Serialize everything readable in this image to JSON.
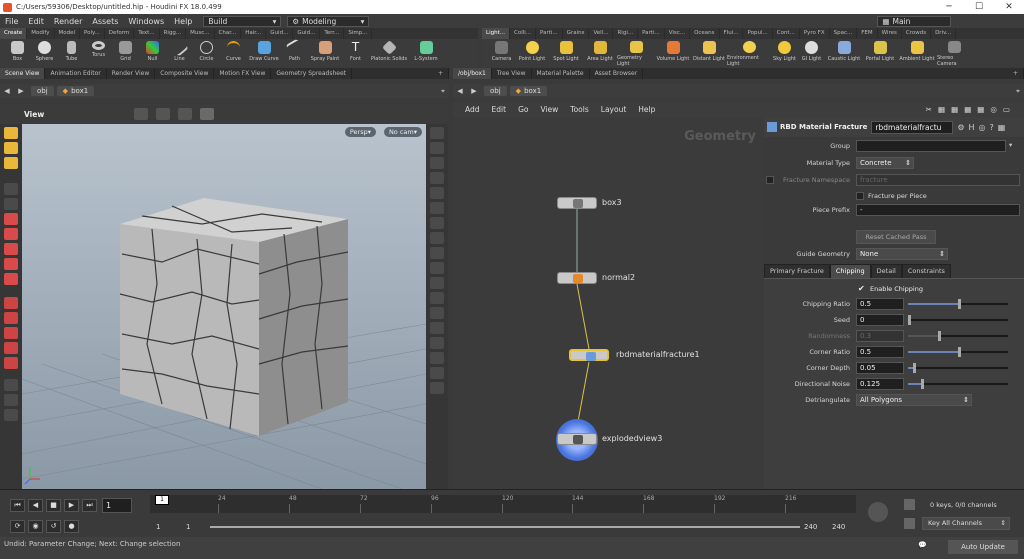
{
  "title": "C:/Users/59306/Desktop/untitled.hip - Houdini FX 18.0.499",
  "menu": [
    "File",
    "Edit",
    "Render",
    "Assets",
    "Windows",
    "Help"
  ],
  "desktop_build": "Build",
  "desktop_modeling": "Modeling",
  "desktop_main": "Main",
  "shelf_tabs_left": [
    "Create",
    "Modify",
    "Model",
    "Poly...",
    "Deform",
    "Text...",
    "Rigg...",
    "Musc...",
    "Char...",
    "Hair...",
    "Guid...",
    "Guid...",
    "Terr...",
    "Simp..."
  ],
  "shelf_tabs_right": [
    "Light...",
    "Colli...",
    "Parti...",
    "Grains",
    "Vell...",
    "Rigi...",
    "Parti...",
    "Visc...",
    "Oceans",
    "Flui...",
    "Popul...",
    "Cont...",
    "Pyro FX",
    "Spac...",
    "FEM",
    "Wires",
    "Crowds",
    "Driv..."
  ],
  "shelf_tools_left": [
    "Box",
    "Sphere",
    "Tube",
    "Torus",
    "Grid",
    "Null",
    "Line",
    "Circle",
    "Curve",
    "Draw Curve",
    "Path",
    "Spray Paint",
    "Font",
    "Platonic Solids",
    "L-System"
  ],
  "shelf_tools_right": [
    "Camera",
    "Point Light",
    "Spot Light",
    "Area Light",
    "Geometry Light",
    "Volume Light",
    "Distant Light",
    "Environment Light",
    "Sky Light",
    "GI Light",
    "Caustic Light",
    "Portal Light",
    "Ambient Light",
    "Stereo Camera"
  ],
  "left_pane_tabs": [
    "Scene View",
    "Animation Editor",
    "Render View",
    "Composite View",
    "Motion FX View",
    "Geometry Spreadsheet"
  ],
  "right_pane_tabs": [
    "/obj/box1",
    "Tree View",
    "Material Palette",
    "Asset Browser"
  ],
  "path_obj": "obj",
  "path_box": "box1",
  "view_label": "View",
  "persp": "Persp▾",
  "nocam": "No cam▾",
  "net_menu": [
    "Add",
    "Edit",
    "Go",
    "View",
    "Tools",
    "Layout",
    "Help"
  ],
  "net_watermark": "Geometry",
  "nodes": [
    "box3",
    "normal2",
    "rbdmaterialfracture1",
    "explodedview3"
  ],
  "parm_header": "RBD Material Fracture",
  "parm_name": "rbdmaterialfractu",
  "parms": {
    "group": "Group",
    "material_type": "Material Type",
    "material_type_val": "Concrete",
    "fracture_namespace": "Fracture Namespace",
    "fracture_namespace_val": "fracture",
    "fracture_per_piece": "Fracture per Piece",
    "piece_prefix": "Piece Prefix",
    "piece_prefix_val": "-",
    "reset_cached": "Reset Cached Pass",
    "guide_geometry": "Guide Geometry",
    "guide_geometry_val": "None"
  },
  "parm_tabs": [
    "Primary Fracture",
    "Chipping",
    "Detail",
    "Constraints"
  ],
  "chipping": {
    "enable": "Enable Chipping",
    "rows": [
      {
        "label": "Chipping Ratio",
        "value": "0.5",
        "frac": 0.5
      },
      {
        "label": "Seed",
        "value": "0",
        "frac": 0.0
      },
      {
        "label": "Randomness",
        "value": "0.3",
        "frac": 0.3
      },
      {
        "label": "Corner Ratio",
        "value": "0.5",
        "frac": 0.5
      },
      {
        "label": "Corner Depth",
        "value": "0.05",
        "frac": 0.05
      },
      {
        "label": "Directional Noise",
        "value": "0.125",
        "frac": 0.125
      }
    ],
    "detriangulate": "Detriangulate",
    "detriangulate_val": "All Polygons"
  },
  "timeline": {
    "frame": "1",
    "ticks": [
      "24",
      "48",
      "72",
      "96",
      "120",
      "144",
      "168",
      "192",
      "216"
    ],
    "start": "1",
    "start2": "1",
    "end": "240",
    "end2": "240",
    "keys": "0 keys, 0/0 channels",
    "keyall": "Key All Channels"
  },
  "status": "Undid: Parameter Change; Next: Change selection",
  "auto_update": "Auto Update"
}
